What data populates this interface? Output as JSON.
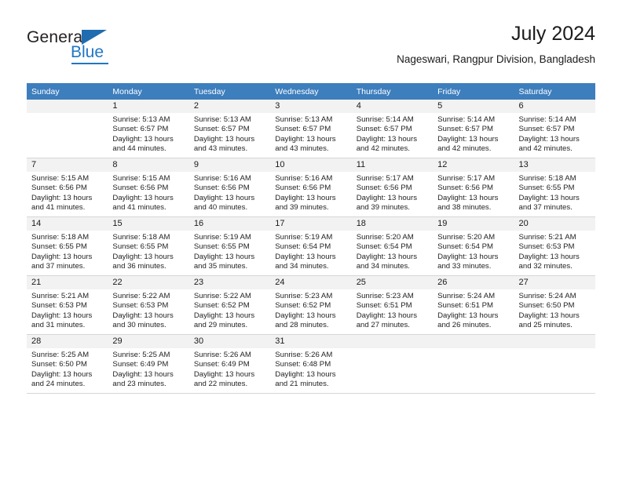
{
  "logo": {
    "word1": "General",
    "word2": "Blue",
    "triangle_color": "#1f6cb0",
    "blue_color": "#2076c4"
  },
  "header": {
    "title": "July 2024",
    "subtitle": "Nageswari, Rangpur Division, Bangladesh"
  },
  "calendar": {
    "header_bg": "#3d7ebd",
    "daynum_bg": "#f2f2f2",
    "weekday_headers": [
      "Sunday",
      "Monday",
      "Tuesday",
      "Wednesday",
      "Thursday",
      "Friday",
      "Saturday"
    ],
    "weeks": [
      [
        {
          "day": "",
          "sunrise": "",
          "sunset": "",
          "daylight1": "",
          "daylight2": ""
        },
        {
          "day": "1",
          "sunrise": "Sunrise: 5:13 AM",
          "sunset": "Sunset: 6:57 PM",
          "daylight1": "Daylight: 13 hours",
          "daylight2": "and 44 minutes."
        },
        {
          "day": "2",
          "sunrise": "Sunrise: 5:13 AM",
          "sunset": "Sunset: 6:57 PM",
          "daylight1": "Daylight: 13 hours",
          "daylight2": "and 43 minutes."
        },
        {
          "day": "3",
          "sunrise": "Sunrise: 5:13 AM",
          "sunset": "Sunset: 6:57 PM",
          "daylight1": "Daylight: 13 hours",
          "daylight2": "and 43 minutes."
        },
        {
          "day": "4",
          "sunrise": "Sunrise: 5:14 AM",
          "sunset": "Sunset: 6:57 PM",
          "daylight1": "Daylight: 13 hours",
          "daylight2": "and 42 minutes."
        },
        {
          "day": "5",
          "sunrise": "Sunrise: 5:14 AM",
          "sunset": "Sunset: 6:57 PM",
          "daylight1": "Daylight: 13 hours",
          "daylight2": "and 42 minutes."
        },
        {
          "day": "6",
          "sunrise": "Sunrise: 5:14 AM",
          "sunset": "Sunset: 6:57 PM",
          "daylight1": "Daylight: 13 hours",
          "daylight2": "and 42 minutes."
        }
      ],
      [
        {
          "day": "7",
          "sunrise": "Sunrise: 5:15 AM",
          "sunset": "Sunset: 6:56 PM",
          "daylight1": "Daylight: 13 hours",
          "daylight2": "and 41 minutes."
        },
        {
          "day": "8",
          "sunrise": "Sunrise: 5:15 AM",
          "sunset": "Sunset: 6:56 PM",
          "daylight1": "Daylight: 13 hours",
          "daylight2": "and 41 minutes."
        },
        {
          "day": "9",
          "sunrise": "Sunrise: 5:16 AM",
          "sunset": "Sunset: 6:56 PM",
          "daylight1": "Daylight: 13 hours",
          "daylight2": "and 40 minutes."
        },
        {
          "day": "10",
          "sunrise": "Sunrise: 5:16 AM",
          "sunset": "Sunset: 6:56 PM",
          "daylight1": "Daylight: 13 hours",
          "daylight2": "and 39 minutes."
        },
        {
          "day": "11",
          "sunrise": "Sunrise: 5:17 AM",
          "sunset": "Sunset: 6:56 PM",
          "daylight1": "Daylight: 13 hours",
          "daylight2": "and 39 minutes."
        },
        {
          "day": "12",
          "sunrise": "Sunrise: 5:17 AM",
          "sunset": "Sunset: 6:56 PM",
          "daylight1": "Daylight: 13 hours",
          "daylight2": "and 38 minutes."
        },
        {
          "day": "13",
          "sunrise": "Sunrise: 5:18 AM",
          "sunset": "Sunset: 6:55 PM",
          "daylight1": "Daylight: 13 hours",
          "daylight2": "and 37 minutes."
        }
      ],
      [
        {
          "day": "14",
          "sunrise": "Sunrise: 5:18 AM",
          "sunset": "Sunset: 6:55 PM",
          "daylight1": "Daylight: 13 hours",
          "daylight2": "and 37 minutes."
        },
        {
          "day": "15",
          "sunrise": "Sunrise: 5:18 AM",
          "sunset": "Sunset: 6:55 PM",
          "daylight1": "Daylight: 13 hours",
          "daylight2": "and 36 minutes."
        },
        {
          "day": "16",
          "sunrise": "Sunrise: 5:19 AM",
          "sunset": "Sunset: 6:55 PM",
          "daylight1": "Daylight: 13 hours",
          "daylight2": "and 35 minutes."
        },
        {
          "day": "17",
          "sunrise": "Sunrise: 5:19 AM",
          "sunset": "Sunset: 6:54 PM",
          "daylight1": "Daylight: 13 hours",
          "daylight2": "and 34 minutes."
        },
        {
          "day": "18",
          "sunrise": "Sunrise: 5:20 AM",
          "sunset": "Sunset: 6:54 PM",
          "daylight1": "Daylight: 13 hours",
          "daylight2": "and 34 minutes."
        },
        {
          "day": "19",
          "sunrise": "Sunrise: 5:20 AM",
          "sunset": "Sunset: 6:54 PM",
          "daylight1": "Daylight: 13 hours",
          "daylight2": "and 33 minutes."
        },
        {
          "day": "20",
          "sunrise": "Sunrise: 5:21 AM",
          "sunset": "Sunset: 6:53 PM",
          "daylight1": "Daylight: 13 hours",
          "daylight2": "and 32 minutes."
        }
      ],
      [
        {
          "day": "21",
          "sunrise": "Sunrise: 5:21 AM",
          "sunset": "Sunset: 6:53 PM",
          "daylight1": "Daylight: 13 hours",
          "daylight2": "and 31 minutes."
        },
        {
          "day": "22",
          "sunrise": "Sunrise: 5:22 AM",
          "sunset": "Sunset: 6:53 PM",
          "daylight1": "Daylight: 13 hours",
          "daylight2": "and 30 minutes."
        },
        {
          "day": "23",
          "sunrise": "Sunrise: 5:22 AM",
          "sunset": "Sunset: 6:52 PM",
          "daylight1": "Daylight: 13 hours",
          "daylight2": "and 29 minutes."
        },
        {
          "day": "24",
          "sunrise": "Sunrise: 5:23 AM",
          "sunset": "Sunset: 6:52 PM",
          "daylight1": "Daylight: 13 hours",
          "daylight2": "and 28 minutes."
        },
        {
          "day": "25",
          "sunrise": "Sunrise: 5:23 AM",
          "sunset": "Sunset: 6:51 PM",
          "daylight1": "Daylight: 13 hours",
          "daylight2": "and 27 minutes."
        },
        {
          "day": "26",
          "sunrise": "Sunrise: 5:24 AM",
          "sunset": "Sunset: 6:51 PM",
          "daylight1": "Daylight: 13 hours",
          "daylight2": "and 26 minutes."
        },
        {
          "day": "27",
          "sunrise": "Sunrise: 5:24 AM",
          "sunset": "Sunset: 6:50 PM",
          "daylight1": "Daylight: 13 hours",
          "daylight2": "and 25 minutes."
        }
      ],
      [
        {
          "day": "28",
          "sunrise": "Sunrise: 5:25 AM",
          "sunset": "Sunset: 6:50 PM",
          "daylight1": "Daylight: 13 hours",
          "daylight2": "and 24 minutes."
        },
        {
          "day": "29",
          "sunrise": "Sunrise: 5:25 AM",
          "sunset": "Sunset: 6:49 PM",
          "daylight1": "Daylight: 13 hours",
          "daylight2": "and 23 minutes."
        },
        {
          "day": "30",
          "sunrise": "Sunrise: 5:26 AM",
          "sunset": "Sunset: 6:49 PM",
          "daylight1": "Daylight: 13 hours",
          "daylight2": "and 22 minutes."
        },
        {
          "day": "31",
          "sunrise": "Sunrise: 5:26 AM",
          "sunset": "Sunset: 6:48 PM",
          "daylight1": "Daylight: 13 hours",
          "daylight2": "and 21 minutes."
        },
        {
          "day": "",
          "sunrise": "",
          "sunset": "",
          "daylight1": "",
          "daylight2": ""
        },
        {
          "day": "",
          "sunrise": "",
          "sunset": "",
          "daylight1": "",
          "daylight2": ""
        },
        {
          "day": "",
          "sunrise": "",
          "sunset": "",
          "daylight1": "",
          "daylight2": ""
        }
      ]
    ]
  }
}
